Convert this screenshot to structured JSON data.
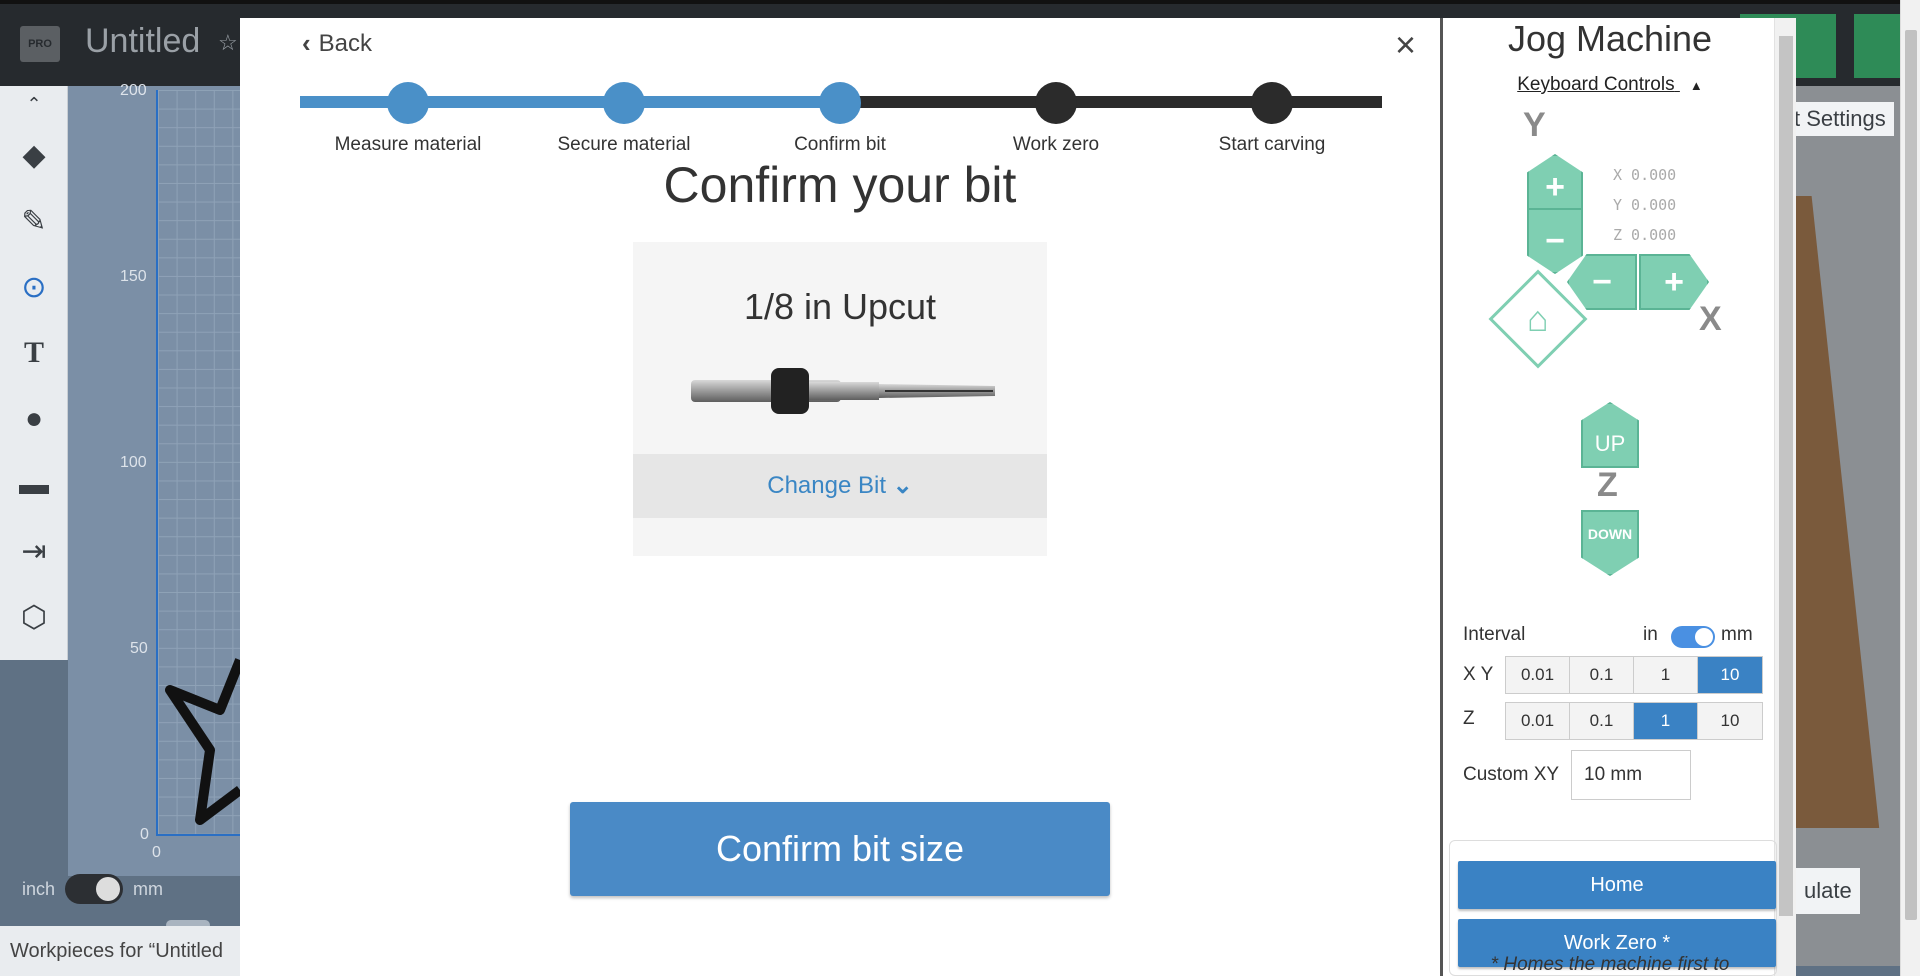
{
  "app": {
    "badge": "PRO",
    "title": "Untitled",
    "workpieces_label": "Workpieces for “Untitled",
    "unit_inch": "inch",
    "unit_mm": "mm",
    "settings_label": "t Settings",
    "simulate_label": "ulate",
    "y_ticks": [
      "200",
      "150",
      "100",
      "50",
      "0"
    ],
    "x_tick": "0"
  },
  "modal": {
    "back_label": "Back",
    "close_label": "×",
    "steps": [
      {
        "label": "Measure material",
        "state": "done"
      },
      {
        "label": "Secure material",
        "state": "done"
      },
      {
        "label": "Confirm bit",
        "state": "current"
      },
      {
        "label": "Work zero",
        "state": "pending"
      },
      {
        "label": "Start carving",
        "state": "pending"
      }
    ],
    "heading": "Confirm your bit",
    "bit_name": "1/8 in Upcut",
    "change_bit_label": "Change Bit",
    "confirm_label": "Confirm bit size"
  },
  "jog": {
    "title": "Jog Machine",
    "keyboard_controls": "Keyboard Controls",
    "axis_y": "Y",
    "axis_x": "X",
    "axis_z": "Z",
    "coords": {
      "x": "X 0.000",
      "y": "Y 0.000",
      "z": "Z 0.000"
    },
    "up_label": "UP",
    "down_label": "DOWN",
    "plus": "+",
    "minus": "−",
    "interval_label": "Interval",
    "unit_in": "in",
    "unit_mm": "mm",
    "xy_label": "X Y",
    "z_label": "Z",
    "xy_options": [
      "0.01",
      "0.1",
      "1",
      "10"
    ],
    "xy_selected": "10",
    "z_options": [
      "0.01",
      "0.1",
      "1",
      "10"
    ],
    "z_selected": "1",
    "custom_xy_label": "Custom XY",
    "custom_xy_value": "10 mm",
    "home_label": "Home",
    "work_zero_label": "Work Zero *",
    "footnote": "* Homes the machine first to"
  },
  "colors": {
    "accent_blue": "#4a8ac6",
    "jog_green": "#7fcfb2",
    "progress_done": "#4a90c8",
    "progress_pending": "#2b2b2b"
  }
}
